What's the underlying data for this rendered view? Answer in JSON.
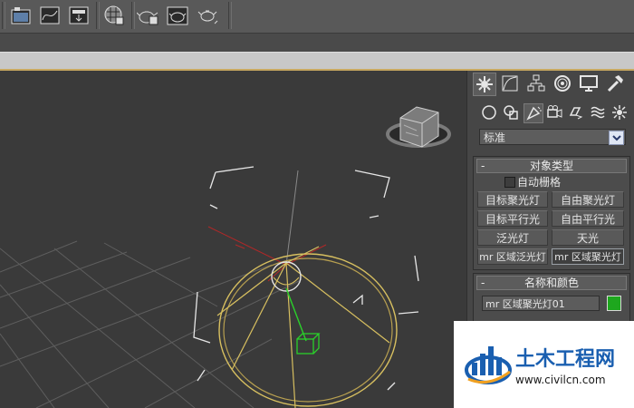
{
  "toolbar": {
    "icons": [
      "render-setup-icon",
      "curve-editor-icon",
      "render-frame-icon",
      "material-editor-icon",
      "teapot-render-icon",
      "teapot-render-production-icon",
      "teapot-render-iterative-icon"
    ]
  },
  "command_panel": {
    "tabs": [
      "create-tab",
      "modify-tab",
      "hierarchy-tab",
      "motion-tab",
      "display-tab",
      "utilities-tab"
    ],
    "subcategories": [
      "geometry",
      "shapes",
      "lights",
      "cameras",
      "helpers",
      "space-warps",
      "systems"
    ],
    "dropdown_value": "标准",
    "object_type": {
      "header": "对象类型",
      "auto_grid": "自动栅格",
      "buttons": [
        "目标聚光灯",
        "自由聚光灯",
        "目标平行光",
        "自由平行光",
        "泛光灯",
        "天光",
        "mr 区域泛光灯",
        "mr 区域聚光灯"
      ]
    },
    "name_color": {
      "header": "名称和颜色",
      "name": "mr 区域聚光灯01",
      "color": "#1ea71e"
    }
  },
  "watermark": {
    "title": "土木工程网",
    "url": "www.civilcn.com"
  }
}
